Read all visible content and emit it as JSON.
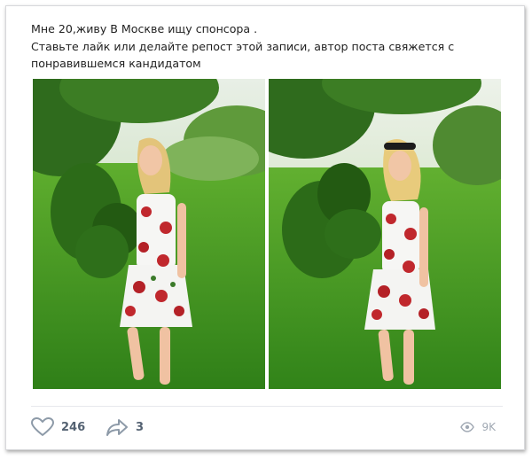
{
  "post": {
    "text_lines": [
      "Мне 20,живу В Москве ищу спонсора .",
      "Ставьте лайк или делайте репост этой записи, автор поста свяжется с",
      "понравившемся кандидатом"
    ]
  },
  "photos": [
    {
      "name": "photo-left"
    },
    {
      "name": "photo-right"
    }
  ],
  "footer": {
    "likes": "246",
    "shares": "3",
    "views": "9K"
  },
  "icons": {
    "like": "heart-icon",
    "share": "share-arrow-icon",
    "views": "eye-icon"
  },
  "colors": {
    "text": "#1f1f1f",
    "action_text": "#546272",
    "views_text": "#a0a8b3",
    "border": "#d7d8db"
  }
}
